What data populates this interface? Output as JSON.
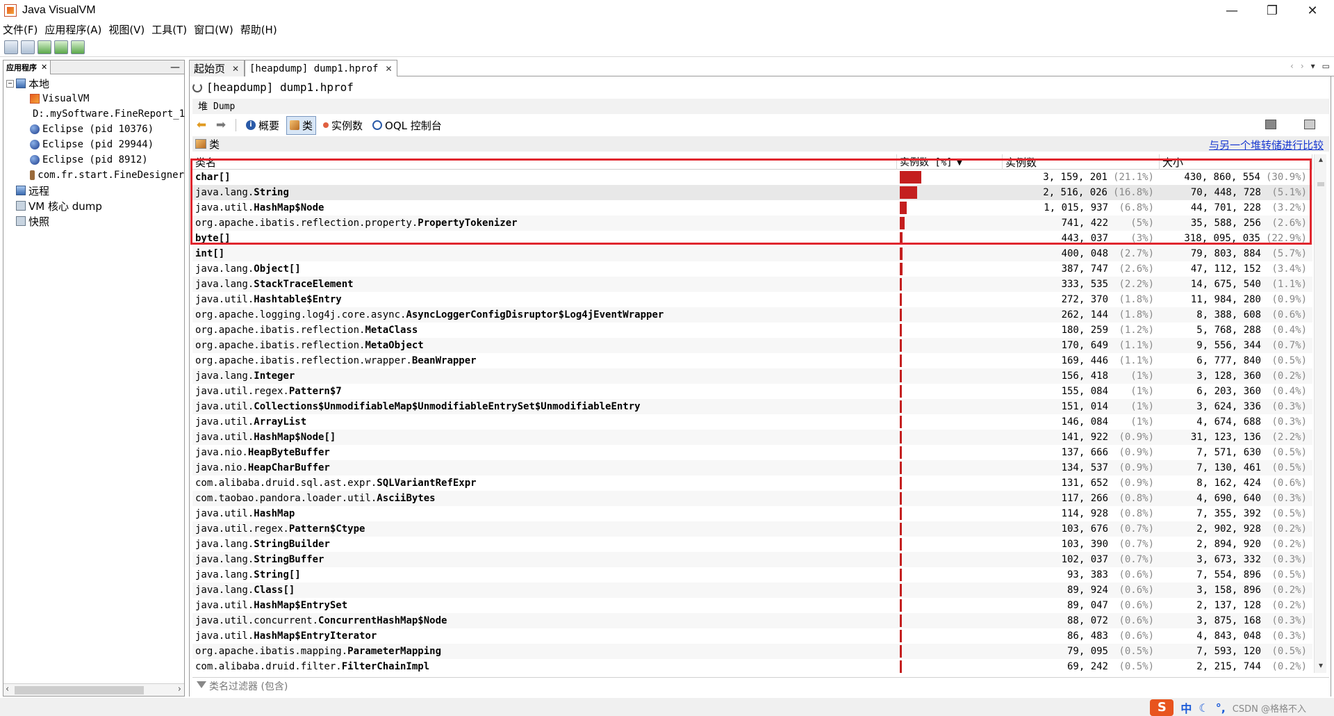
{
  "window": {
    "title": "Java VisualVM",
    "controls": {
      "minimize": "—",
      "maximize": "❐",
      "close": "✕"
    }
  },
  "menu": [
    "文件(F)",
    "应用程序(A)",
    "视图(V)",
    "工具(T)",
    "窗口(W)",
    "帮助(H)"
  ],
  "left_panel": {
    "tab_label": "应用程序",
    "tab_close": "✕",
    "minimize": "—",
    "tree": [
      {
        "label": "本地",
        "level": 0,
        "icon": "computer",
        "expander": "−"
      },
      {
        "label": "VisualVM",
        "level": 1,
        "icon": "vvm"
      },
      {
        "label": "D:.mySoftware.FineReport_1",
        "level": 1,
        "icon": "coffee"
      },
      {
        "label": "Eclipse (pid 10376)",
        "level": 1,
        "icon": "globe"
      },
      {
        "label": "Eclipse (pid 29944)",
        "level": 1,
        "icon": "globe"
      },
      {
        "label": "Eclipse (pid 8912)",
        "level": 1,
        "icon": "globe"
      },
      {
        "label": "com.fr.start.FineDesigner",
        "level": 1,
        "icon": "coffee"
      },
      {
        "label": "远程",
        "level": 0,
        "icon": "computer",
        "expander": ""
      },
      {
        "label": "VM 核心 dump",
        "level": 0,
        "icon": "folder",
        "expander": ""
      },
      {
        "label": "快照",
        "level": 0,
        "icon": "folder",
        "expander": ""
      }
    ]
  },
  "doc_tabs": [
    {
      "label": "起始页",
      "close": "✕"
    },
    {
      "label": "[heapdump] dump1.hprof",
      "close": "✕"
    }
  ],
  "dump": {
    "title": "[heapdump] dump1.hprof",
    "heap_label": "堆",
    "heap_sub": "Dump",
    "views": {
      "summary": "概要",
      "classes": "类",
      "instances": "实例数",
      "oql": "OQL 控制台"
    },
    "classes_header": "类",
    "compare_link": "与另一个堆转储进行比较"
  },
  "table": {
    "headers": {
      "name": "类名",
      "bar": "实例数 [%]",
      "count": "实例数",
      "size": "大小"
    },
    "rows": [
      {
        "pkg": "",
        "cls": "char[]",
        "count": "3, 159, 201",
        "count_pct": "(21.1%)",
        "size": "430, 860, 554",
        "size_pct": "(30.9%)",
        "pct": 21.1
      },
      {
        "pkg": "java.lang.",
        "cls": "String",
        "count": "2, 516, 026",
        "count_pct": "(16.8%)",
        "size": "70, 448, 728",
        "size_pct": "(5.1%)",
        "pct": 16.8
      },
      {
        "pkg": "java.util.",
        "cls": "HashMap$Node",
        "count": "1, 015, 937",
        "count_pct": "(6.8%)",
        "size": "44, 701, 228",
        "size_pct": "(3.2%)",
        "pct": 6.8
      },
      {
        "pkg": "org.apache.ibatis.reflection.property.",
        "cls": "PropertyTokenizer",
        "count": "741, 422",
        "count_pct": "(5%)",
        "size": "35, 588, 256",
        "size_pct": "(2.6%)",
        "pct": 5
      },
      {
        "pkg": "",
        "cls": "byte[]",
        "count": "443, 037",
        "count_pct": "(3%)",
        "size": "318, 095, 035",
        "size_pct": "(22.9%)",
        "pct": 3
      },
      {
        "pkg": "",
        "cls": "int[]",
        "count": "400, 048",
        "count_pct": "(2.7%)",
        "size": "79, 803, 884",
        "size_pct": "(5.7%)",
        "pct": 2.7
      },
      {
        "pkg": "java.lang.",
        "cls": "Object[]",
        "count": "387, 747",
        "count_pct": "(2.6%)",
        "size": "47, 112, 152",
        "size_pct": "(3.4%)",
        "pct": 2.6
      },
      {
        "pkg": "java.lang.",
        "cls": "StackTraceElement",
        "count": "333, 535",
        "count_pct": "(2.2%)",
        "size": "14, 675, 540",
        "size_pct": "(1.1%)",
        "pct": 2.2
      },
      {
        "pkg": "java.util.",
        "cls": "Hashtable$Entry",
        "count": "272, 370",
        "count_pct": "(1.8%)",
        "size": "11, 984, 280",
        "size_pct": "(0.9%)",
        "pct": 1.8
      },
      {
        "pkg": "org.apache.logging.log4j.core.async.",
        "cls": "AsyncLoggerConfigDisruptor$Log4jEventWrapper",
        "count": "262, 144",
        "count_pct": "(1.8%)",
        "size": "8, 388, 608",
        "size_pct": "(0.6%)",
        "pct": 1.8
      },
      {
        "pkg": "org.apache.ibatis.reflection.",
        "cls": "MetaClass",
        "count": "180, 259",
        "count_pct": "(1.2%)",
        "size": "5, 768, 288",
        "size_pct": "(0.4%)",
        "pct": 1.2
      },
      {
        "pkg": "org.apache.ibatis.reflection.",
        "cls": "MetaObject",
        "count": "170, 649",
        "count_pct": "(1.1%)",
        "size": "9, 556, 344",
        "size_pct": "(0.7%)",
        "pct": 1.1
      },
      {
        "pkg": "org.apache.ibatis.reflection.wrapper.",
        "cls": "BeanWrapper",
        "count": "169, 446",
        "count_pct": "(1.1%)",
        "size": "6, 777, 840",
        "size_pct": "(0.5%)",
        "pct": 1.1
      },
      {
        "pkg": "java.lang.",
        "cls": "Integer",
        "count": "156, 418",
        "count_pct": "(1%)",
        "size": "3, 128, 360",
        "size_pct": "(0.2%)",
        "pct": 1
      },
      {
        "pkg": "java.util.regex.",
        "cls": "Pattern$7",
        "count": "155, 084",
        "count_pct": "(1%)",
        "size": "6, 203, 360",
        "size_pct": "(0.4%)",
        "pct": 1
      },
      {
        "pkg": "java.util.",
        "cls": "Collections$UnmodifiableMap$UnmodifiableEntrySet$UnmodifiableEntry",
        "count": "151, 014",
        "count_pct": "(1%)",
        "size": "3, 624, 336",
        "size_pct": "(0.3%)",
        "pct": 1
      },
      {
        "pkg": "java.util.",
        "cls": "ArrayList",
        "count": "146, 084",
        "count_pct": "(1%)",
        "size": "4, 674, 688",
        "size_pct": "(0.3%)",
        "pct": 1
      },
      {
        "pkg": "java.util.",
        "cls": "HashMap$Node[]",
        "count": "141, 922",
        "count_pct": "(0.9%)",
        "size": "31, 123, 136",
        "size_pct": "(2.2%)",
        "pct": 0.9
      },
      {
        "pkg": "java.nio.",
        "cls": "HeapByteBuffer",
        "count": "137, 666",
        "count_pct": "(0.9%)",
        "size": "7, 571, 630",
        "size_pct": "(0.5%)",
        "pct": 0.9
      },
      {
        "pkg": "java.nio.",
        "cls": "HeapCharBuffer",
        "count": "134, 537",
        "count_pct": "(0.9%)",
        "size": "7, 130, 461",
        "size_pct": "(0.5%)",
        "pct": 0.9
      },
      {
        "pkg": "com.alibaba.druid.sql.ast.expr.",
        "cls": "SQLVariantRefExpr",
        "count": "131, 652",
        "count_pct": "(0.9%)",
        "size": "8, 162, 424",
        "size_pct": "(0.6%)",
        "pct": 0.9
      },
      {
        "pkg": "com.taobao.pandora.loader.util.",
        "cls": "AsciiBytes",
        "count": "117, 266",
        "count_pct": "(0.8%)",
        "size": "4, 690, 640",
        "size_pct": "(0.3%)",
        "pct": 0.8
      },
      {
        "pkg": "java.util.",
        "cls": "HashMap",
        "count": "114, 928",
        "count_pct": "(0.8%)",
        "size": "7, 355, 392",
        "size_pct": "(0.5%)",
        "pct": 0.8
      },
      {
        "pkg": "java.util.regex.",
        "cls": "Pattern$Ctype",
        "count": "103, 676",
        "count_pct": "(0.7%)",
        "size": "2, 902, 928",
        "size_pct": "(0.2%)",
        "pct": 0.7
      },
      {
        "pkg": "java.lang.",
        "cls": "StringBuilder",
        "count": "103, 390",
        "count_pct": "(0.7%)",
        "size": "2, 894, 920",
        "size_pct": "(0.2%)",
        "pct": 0.7
      },
      {
        "pkg": "java.lang.",
        "cls": "StringBuffer",
        "count": "102, 037",
        "count_pct": "(0.7%)",
        "size": "3, 673, 332",
        "size_pct": "(0.3%)",
        "pct": 0.7
      },
      {
        "pkg": "java.lang.",
        "cls": "String[]",
        "count": "93, 383",
        "count_pct": "(0.6%)",
        "size": "7, 554, 896",
        "size_pct": "(0.5%)",
        "pct": 0.6
      },
      {
        "pkg": "java.lang.",
        "cls": "Class[]",
        "count": "89, 924",
        "count_pct": "(0.6%)",
        "size": "3, 158, 896",
        "size_pct": "(0.2%)",
        "pct": 0.6
      },
      {
        "pkg": "java.util.",
        "cls": "HashMap$EntrySet",
        "count": "89, 047",
        "count_pct": "(0.6%)",
        "size": "2, 137, 128",
        "size_pct": "(0.2%)",
        "pct": 0.6
      },
      {
        "pkg": "java.util.concurrent.",
        "cls": "ConcurrentHashMap$Node",
        "count": "88, 072",
        "count_pct": "(0.6%)",
        "size": "3, 875, 168",
        "size_pct": "(0.3%)",
        "pct": 0.6
      },
      {
        "pkg": "java.util.",
        "cls": "HashMap$EntryIterator",
        "count": "86, 483",
        "count_pct": "(0.6%)",
        "size": "4, 843, 048",
        "size_pct": "(0.3%)",
        "pct": 0.6
      },
      {
        "pkg": "org.apache.ibatis.mapping.",
        "cls": "ParameterMapping",
        "count": "79, 095",
        "count_pct": "(0.5%)",
        "size": "7, 593, 120",
        "size_pct": "(0.5%)",
        "pct": 0.5
      },
      {
        "pkg": "com.alibaba.druid.filter.",
        "cls": "FilterChainImpl",
        "count": "69, 242",
        "count_pct": "(0.5%)",
        "size": "2, 215, 744",
        "size_pct": "(0.2%)",
        "pct": 0.5
      }
    ]
  },
  "filter": {
    "placeholder": "类名过滤器 (包含)"
  },
  "ime": {
    "logo": "S",
    "lang": "中",
    "watermark": "CSDN @格格不入"
  }
}
